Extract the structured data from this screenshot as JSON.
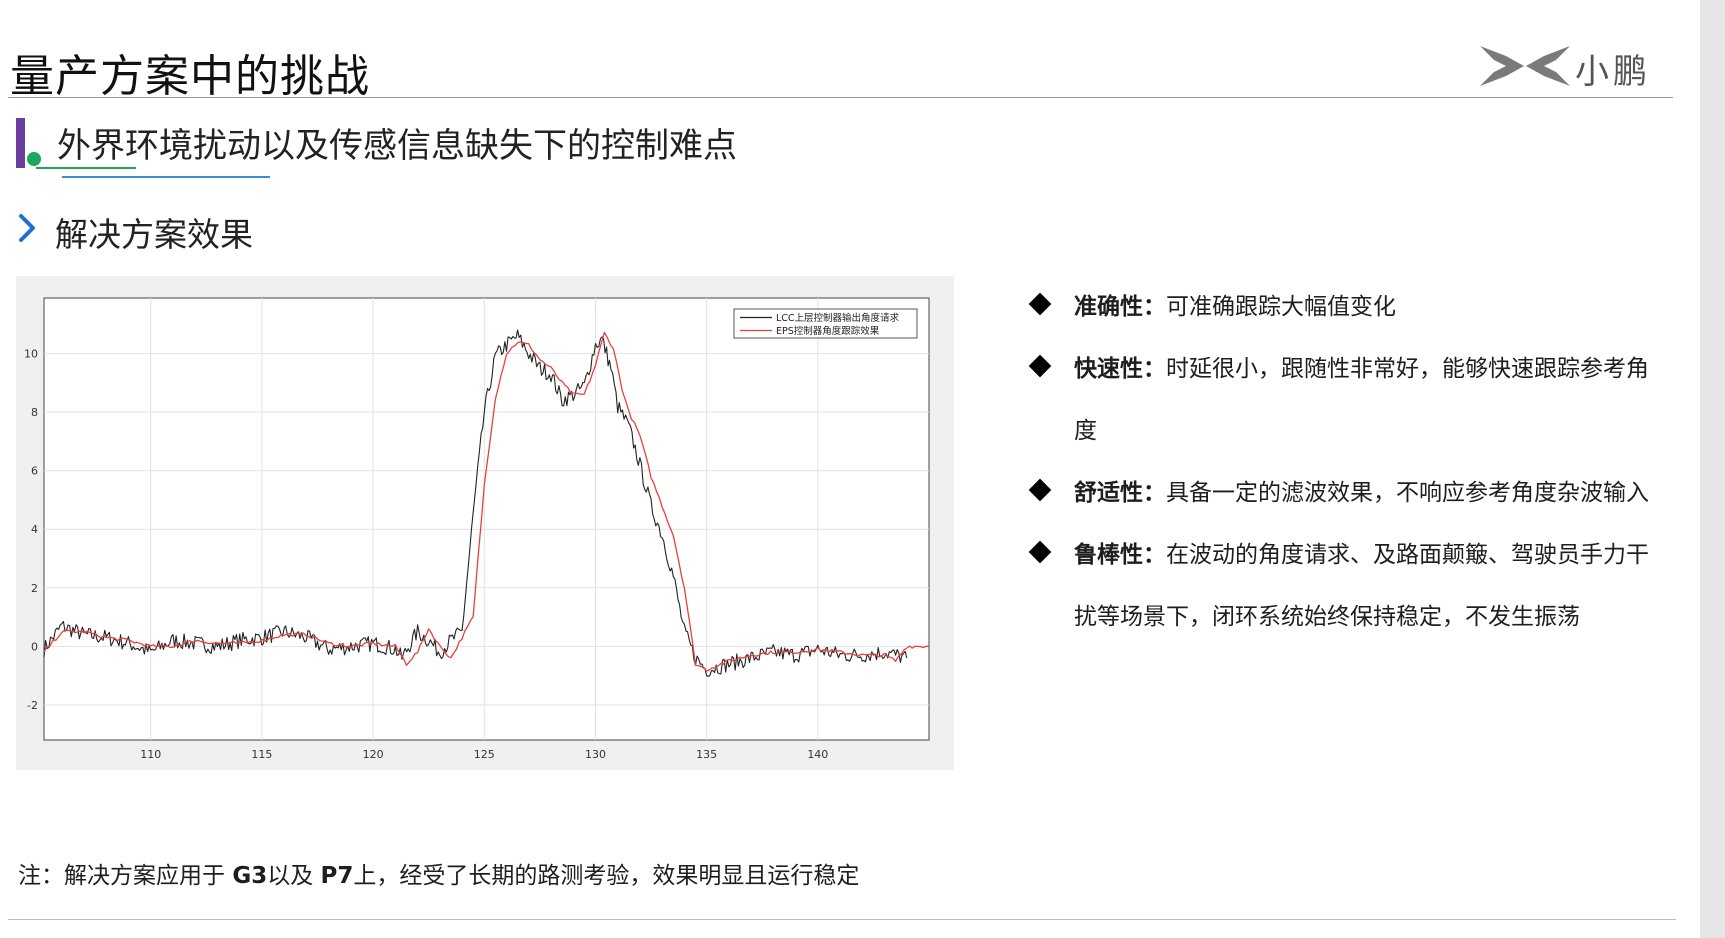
{
  "slide": {
    "title": "量产方案中的挑战",
    "logo_text": "小鹏"
  },
  "section": {
    "title": "外界环境扰动以及传感信息缺失下的控制难点",
    "subtitle": "解决方案效果"
  },
  "colors": {
    "accent_purple": "#6b3fa0",
    "accent_green": "#1aa85b",
    "accent_blue": "#3a8fd8",
    "chevron_blue": "#1f6fd1",
    "series_black": "#222222",
    "series_red": "#e8403a"
  },
  "bullets": [
    {
      "keyword": "准确性：",
      "text": "可准确跟踪大幅值变化"
    },
    {
      "keyword": "快速性：",
      "text": "时延很小，跟随性非常好，能够快速跟踪参考角度"
    },
    {
      "keyword": "舒适性：",
      "text": "具备一定的滤波效果，不响应参考角度杂波输入"
    },
    {
      "keyword": "鲁棒性：",
      "text": "在波动的角度请求、及路面颠簸、驾驶员手力干扰等场景下，闭环系统始终保持稳定，不发生振荡"
    }
  ],
  "note": {
    "prefix": "注：解决方案应用于 ",
    "model1": "G3",
    "mid": "以及 ",
    "model2": "P7",
    "suffix": "上，经受了长期的路测考验，效果明显且运行稳定"
  },
  "chart_data": {
    "type": "line",
    "title": "",
    "xlabel": "",
    "ylabel": "",
    "xlim": [
      105.2,
      145
    ],
    "ylim": [
      -3.2,
      11.9
    ],
    "xticks": [
      110,
      115,
      120,
      125,
      130,
      135,
      140
    ],
    "yticks": [
      -2,
      0,
      2,
      4,
      6,
      8,
      10
    ],
    "grid": true,
    "legend_position": "top-right",
    "series": [
      {
        "name": "LCC上层控制器输出角度请求",
        "color": "#222222",
        "x": [
          105.2,
          106,
          107,
          108,
          109,
          110,
          111,
          112,
          113,
          114,
          115,
          116,
          117,
          118,
          119,
          120,
          121,
          121.3,
          122,
          122.5,
          123,
          123.5,
          124,
          124.5,
          125,
          125.5,
          126,
          126.5,
          127,
          127.5,
          128,
          128.5,
          129,
          129.5,
          130,
          130.3,
          130.7,
          131,
          131.5,
          132,
          132.5,
          133,
          133.5,
          134,
          134.5,
          135,
          136,
          137,
          138,
          139,
          140,
          141,
          142,
          143,
          144
        ],
        "y": [
          -0.1,
          0.7,
          0.4,
          0.3,
          0.1,
          -0.2,
          0.2,
          0.1,
          0.0,
          0.2,
          0.3,
          0.5,
          0.3,
          -0.1,
          0.0,
          0.1,
          -0.1,
          -0.4,
          0.5,
          0.2,
          -0.2,
          0.2,
          0.5,
          4.5,
          8.0,
          9.9,
          10.3,
          10.6,
          10.0,
          9.5,
          9.3,
          8.4,
          8.6,
          8.9,
          10.3,
          10.5,
          9.5,
          8.2,
          7.5,
          6.2,
          4.8,
          3.8,
          2.4,
          0.5,
          -0.4,
          -0.8,
          -0.6,
          -0.4,
          -0.2,
          -0.3,
          -0.1,
          -0.3,
          -0.3,
          -0.2,
          -0.4
        ]
      },
      {
        "name": "EPS控制器角度跟踪效果",
        "color": "#e8403a",
        "x": [
          105.2,
          106,
          107,
          108,
          109,
          110,
          111,
          112,
          113,
          114,
          115,
          116,
          117,
          118,
          119,
          120,
          121,
          121.5,
          122,
          122.5,
          123,
          123.5,
          124,
          124.5,
          125,
          125.5,
          126,
          126.5,
          127,
          127.5,
          128,
          128.5,
          129,
          129.5,
          130,
          130.4,
          130.8,
          131.2,
          131.5,
          132,
          132.5,
          133,
          133.5,
          134,
          134.5,
          135,
          136,
          137,
          138,
          139,
          140,
          141,
          142,
          143,
          143.5,
          144,
          145
        ],
        "y": [
          -0.2,
          0.5,
          0.5,
          0.3,
          0.2,
          0.0,
          0.0,
          0.2,
          0.1,
          0.1,
          0.2,
          0.4,
          0.4,
          0.1,
          0.0,
          0.1,
          0.0,
          -0.6,
          -0.2,
          0.6,
          0.0,
          -0.4,
          0.3,
          1.0,
          5.5,
          8.5,
          10.0,
          10.4,
          10.3,
          9.8,
          9.5,
          9.0,
          8.6,
          8.6,
          9.6,
          10.7,
          10.2,
          8.8,
          8.0,
          7.2,
          5.8,
          4.8,
          3.8,
          2.0,
          -0.6,
          -0.8,
          -0.5,
          -0.3,
          -0.2,
          -0.2,
          -0.1,
          -0.2,
          -0.3,
          -0.3,
          -0.5,
          0.0,
          0.0
        ]
      }
    ]
  }
}
